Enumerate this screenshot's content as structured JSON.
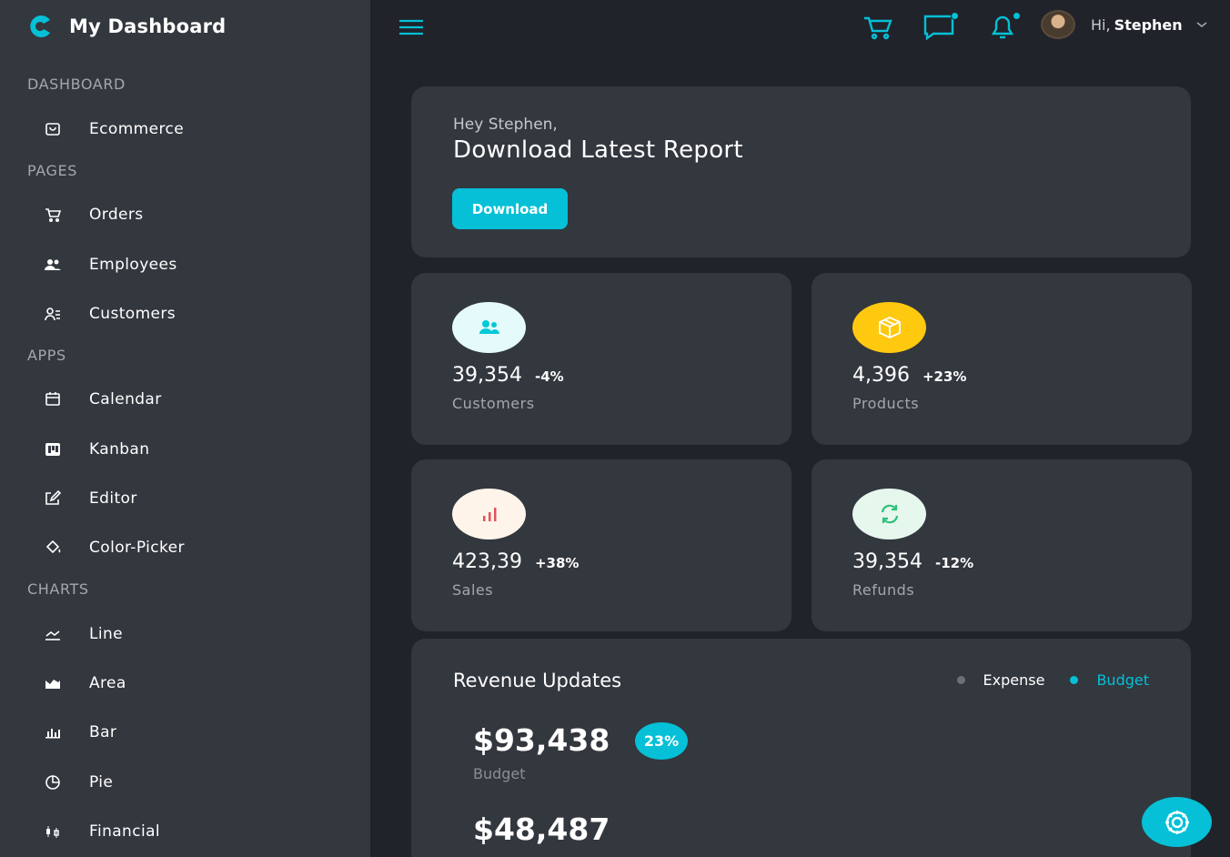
{
  "brand": {
    "name": "My Dashboard"
  },
  "sidebar": {
    "sections": [
      {
        "title": "DASHBOARD",
        "items": [
          {
            "label": "Ecommerce",
            "icon": "shopping-bag-icon"
          }
        ]
      },
      {
        "title": "PAGES",
        "items": [
          {
            "label": "Orders",
            "icon": "cart-icon"
          },
          {
            "label": "Employees",
            "icon": "people-icon"
          },
          {
            "label": "Customers",
            "icon": "customer-list-icon"
          }
        ]
      },
      {
        "title": "APPS",
        "items": [
          {
            "label": "Calendar",
            "icon": "calendar-icon"
          },
          {
            "label": "Kanban",
            "icon": "kanban-icon"
          },
          {
            "label": "Editor",
            "icon": "edit-icon"
          },
          {
            "label": "Color-Picker",
            "icon": "paint-bucket-icon"
          }
        ]
      },
      {
        "title": "CHARTS",
        "items": [
          {
            "label": "Line",
            "icon": "line-chart-icon"
          },
          {
            "label": "Area",
            "icon": "area-chart-icon"
          },
          {
            "label": "Bar",
            "icon": "bar-chart-icon"
          },
          {
            "label": "Pie",
            "icon": "pie-chart-icon"
          },
          {
            "label": "Financial",
            "icon": "financial-icon"
          }
        ]
      }
    ]
  },
  "topbar": {
    "menu_icon": "hamburger-icon",
    "icons": [
      "cart-icon",
      "chat-icon",
      "bell-icon"
    ],
    "greeting": "Hi,",
    "user_name": "Stephen"
  },
  "hero": {
    "subtitle": "Hey Stephen,",
    "title": "Download Latest Report",
    "button_label": "Download"
  },
  "stats": [
    {
      "value": "39,354",
      "change": "-4%",
      "label": "Customers",
      "icon": "customers-icon",
      "icon_color": "#03c9d7",
      "bg": "#e5fafb"
    },
    {
      "value": "4,396",
      "change": "+23%",
      "label": "Products",
      "icon": "box-icon",
      "icon_color": "#ffffff",
      "bg": "#fec90f"
    },
    {
      "value": "423,39",
      "change": "+38%",
      "label": "Sales",
      "icon": "bar-chart-icon",
      "icon_color": "#e4505c",
      "bg": "#fff4ea"
    },
    {
      "value": "39,354",
      "change": "-12%",
      "label": "Refunds",
      "icon": "refresh-icon",
      "icon_color": "#2ec17a",
      "bg": "#e6f7ee"
    }
  ],
  "revenue": {
    "title": "Revenue Updates",
    "legend": [
      {
        "label": "Expense",
        "color": "#6b6f76"
      },
      {
        "label": "Budget",
        "color": "#05c0d6"
      }
    ],
    "budget_value": "$93,438",
    "budget_badge": "23%",
    "budget_label": "Budget",
    "expense_value": "$48,487"
  },
  "colors": {
    "accent": "#05c0d6",
    "sidebar_bg": "#33373e",
    "page_bg": "#20232a"
  }
}
